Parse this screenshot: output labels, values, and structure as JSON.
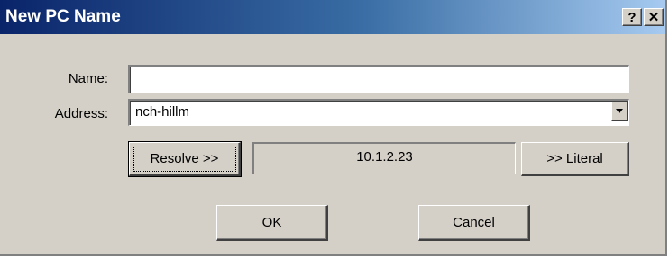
{
  "window": {
    "title": "New PC Name",
    "help_button": "?",
    "close_button": "✕"
  },
  "form": {
    "name_label": "Name:",
    "name_value": "",
    "address_label": "Address:",
    "address_value": "nch-hillm",
    "resolved_ip": "10.1.2.23"
  },
  "buttons": {
    "resolve": "Resolve >>",
    "literal": ">> Literal",
    "ok": "OK",
    "cancel": "Cancel"
  },
  "icons": {
    "dropdown": "chevron-down-icon"
  }
}
